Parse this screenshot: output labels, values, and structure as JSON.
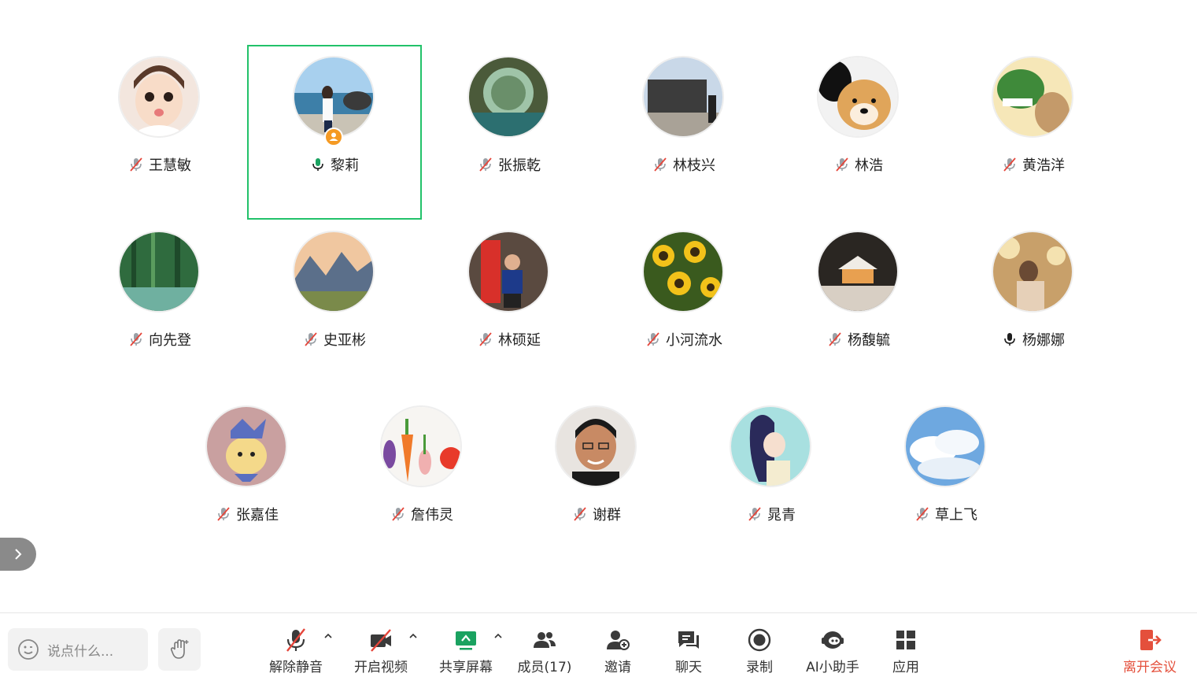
{
  "participants": [
    {
      "name": "王慧敏",
      "muted": true
    },
    {
      "name": "黎莉",
      "muted": false,
      "speaking": true,
      "host": true
    },
    {
      "name": "张振乾",
      "muted": true
    },
    {
      "name": "林枝兴",
      "muted": true
    },
    {
      "name": "林浩",
      "muted": true
    },
    {
      "name": "黄浩洋",
      "muted": true
    },
    {
      "name": "向先登",
      "muted": true
    },
    {
      "name": "史亚彬",
      "muted": true
    },
    {
      "name": "林硕延",
      "muted": true
    },
    {
      "name": "小河流水",
      "muted": true
    },
    {
      "name": "杨馥毓",
      "muted": true
    },
    {
      "name": "杨娜娜",
      "muted": false
    },
    {
      "name": "张嘉佳",
      "muted": true
    },
    {
      "name": "詹伟灵",
      "muted": true
    },
    {
      "name": "谢群",
      "muted": true
    },
    {
      "name": "晁青",
      "muted": true
    },
    {
      "name": "草上飞",
      "muted": true
    }
  ],
  "toolbar": {
    "chat_placeholder": "说点什么...",
    "unmute": "解除静音",
    "start_video": "开启视频",
    "share_screen": "共享屏幕",
    "members": "成员(17)",
    "invite": "邀请",
    "chat": "聊天",
    "record": "录制",
    "ai_assistant": "AI小助手",
    "apps": "应用",
    "leave": "离开会议"
  },
  "colors": {
    "speaking_border": "#22c26a",
    "active_mic": "#1aa260",
    "muted_red": "#e5453a",
    "leave_red": "#e4503c",
    "host_badge": "#f59a23",
    "share_green": "#1aa260"
  },
  "icons": {
    "chat_box": "emoji-icon",
    "raise_hand": "hand-icon",
    "collapse": "chevron-right-icon"
  }
}
